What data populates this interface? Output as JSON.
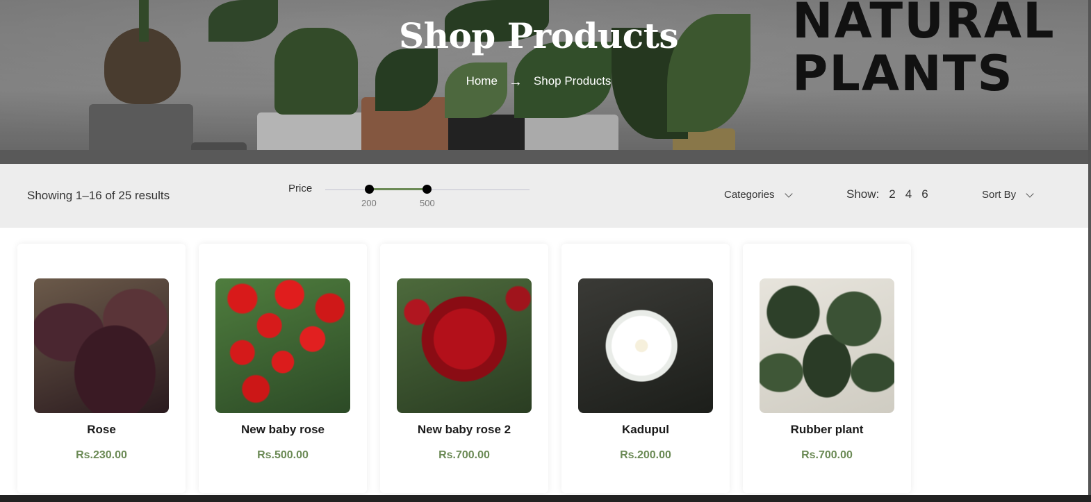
{
  "hero": {
    "title": "Shop Products",
    "breadcrumb": {
      "home": "Home",
      "separator": "→",
      "current": "Shop Products"
    },
    "big_text_line1": "NATURAL",
    "big_text_line2": "PLANTS"
  },
  "filters": {
    "results_text": "Showing 1–16 of 25 results",
    "price_label": "Price",
    "price_min": "200",
    "price_max": "500",
    "categories_label": "Categories",
    "show_label": "Show:",
    "show_options": [
      "2",
      "4",
      "6"
    ],
    "sort_label": "Sort By"
  },
  "products": [
    {
      "name": "Rose",
      "price": "Rs.230.00"
    },
    {
      "name": "New baby rose",
      "price": "Rs.500.00"
    },
    {
      "name": "New baby rose 2",
      "price": "Rs.700.00"
    },
    {
      "name": "Kadupul",
      "price": "Rs.200.00"
    },
    {
      "name": "Rubber plant",
      "price": "Rs.700.00"
    }
  ],
  "colors": {
    "accent": "#6b8a55",
    "filter_bg": "#ededed"
  }
}
